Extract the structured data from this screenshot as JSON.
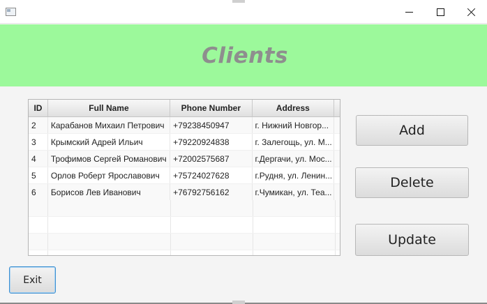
{
  "window": {
    "icon": "app-window-icon",
    "controls": {
      "minimize_icon": "minimize-icon",
      "maximize_icon": "maximize-icon",
      "close_icon": "close-icon"
    }
  },
  "header": {
    "title": "Clients",
    "background": "#9cf99b",
    "title_color": "#8e8e8e"
  },
  "table": {
    "columns": [
      "ID",
      "Full Name",
      "Phone Number",
      "Address"
    ],
    "rows": [
      {
        "id": "2",
        "name": "Карабанов Михаил Петрович",
        "phone": "+79238450947",
        "address": "г. Нижний Новгор..."
      },
      {
        "id": "3",
        "name": "Крымский Адрей Ильич",
        "phone": "+79220924838",
        "address": "г. Залегощь, ул. М..."
      },
      {
        "id": "4",
        "name": "Трофимов Сергей Романович",
        "phone": "+72002575687",
        "address": "г.Дергачи, ул. Мос..."
      },
      {
        "id": "5",
        "name": "Орлов Роберт Ярославович",
        "phone": "+75724027628",
        "address": "г.Рудня, ул. Ленин..."
      },
      {
        "id": "6",
        "name": "Борисов Лев Иванович",
        "phone": "+76792756162",
        "address": "г.Чумикан, ул. Теа..."
      }
    ]
  },
  "actions": {
    "add_label": "Add",
    "delete_label": "Delete",
    "update_label": "Update",
    "exit_label": "Exit"
  }
}
